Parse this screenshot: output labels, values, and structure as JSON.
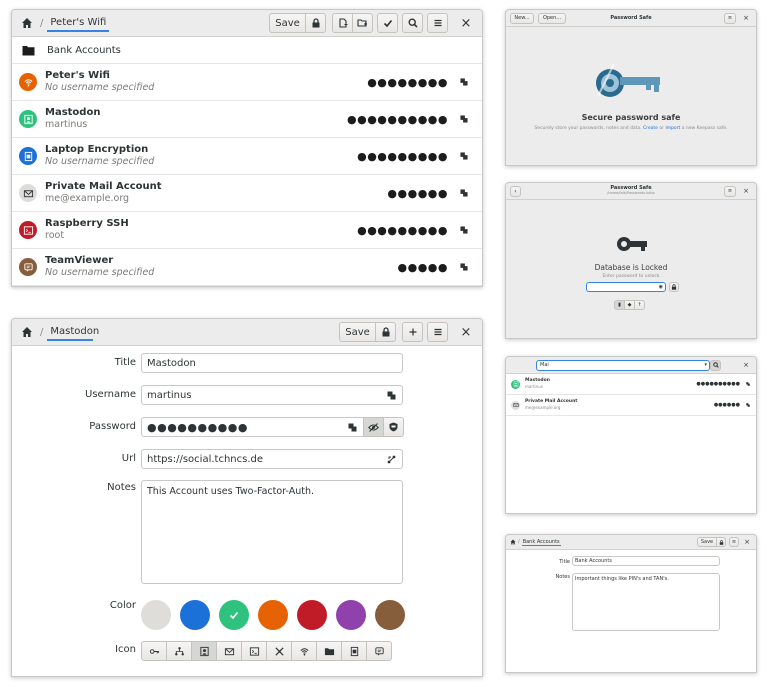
{
  "win1": {
    "breadcrumb": "Peter's Wifi",
    "save_label": "Save",
    "close": "×",
    "folder": "Bank Accounts",
    "entries": [
      {
        "title": "Peter's Wifi",
        "subtitle": "No username specified",
        "italic": true,
        "dots": "●●●●●●●●",
        "color": "#e66100",
        "icon": "wifi-icon"
      },
      {
        "title": "Mastodon",
        "subtitle": "martinus",
        "italic": false,
        "dots": "●●●●●●●●●●",
        "color": "#2ec27e",
        "icon": "contact-icon"
      },
      {
        "title": "Laptop Encryption",
        "subtitle": "No username specified",
        "italic": true,
        "dots": "●●●●●●●●●",
        "color": "#1c71d8",
        "icon": "lock-icon"
      },
      {
        "title": "Private Mail Account",
        "subtitle": "me@example.org",
        "italic": false,
        "dots": "●●●●●●",
        "color": "#deddda",
        "icon": "mail-icon"
      },
      {
        "title": "Raspberry SSH",
        "subtitle": "root",
        "italic": false,
        "dots": "●●●●●●●●●",
        "color": "#c01c28",
        "icon": "terminal-icon"
      },
      {
        "title": "TeamViewer",
        "subtitle": "No username specified",
        "italic": true,
        "dots": "●●●●●",
        "color": "#865e3c",
        "icon": "chat-icon"
      }
    ]
  },
  "win2": {
    "breadcrumb": "Mastodon",
    "save_label": "Save",
    "close": "×",
    "labels": {
      "title": "Title",
      "username": "Username",
      "password": "Password",
      "url": "Url",
      "notes": "Notes",
      "color": "Color",
      "icon": "Icon"
    },
    "values": {
      "title": "Mastodon",
      "username": "martinus",
      "password": "●●●●●●●●●●",
      "url": "https://social.tchncs.de",
      "notes": "This Account uses Two-Factor-Auth."
    },
    "colors": [
      "#deddda",
      "#1c71d8",
      "#2ec27e",
      "#e66100",
      "#c01c28",
      "#9141ac",
      "#865e3c"
    ],
    "selected_color": "#2ec27e",
    "icons": [
      "key-icon",
      "network-icon",
      "contact-icon",
      "mail-icon",
      "terminal-icon",
      "tools-icon",
      "wifi-icon",
      "folder-icon",
      "lock-icon",
      "chat-icon"
    ]
  },
  "win3": {
    "new_label": "New...",
    "open_label": "Open...",
    "title": "Password Safe",
    "heading": "Secure password safe",
    "desc_prefix": "Securely store your passwords, notes and data.",
    "desc_create": "Create",
    "desc_or": "or",
    "desc_import": "import",
    "desc_suffix": "a new Keepass safe."
  },
  "win4": {
    "title": "Password Safe",
    "path": "/home/falk/Passwords.kdbx",
    "heading": "Database is Locked",
    "desc": "Enter password to unlock"
  },
  "win5": {
    "search": "Mai",
    "entries": [
      {
        "title": "Mastodon",
        "subtitle": "martinus",
        "dots": "●●●●●●●●●●",
        "color": "#2ec27e"
      },
      {
        "title": "Private Mail Account",
        "subtitle": "me@example.org",
        "dots": "●●●●●●",
        "color": "#deddda"
      }
    ]
  },
  "win6": {
    "breadcrumb": "Bank Accounts",
    "save_label": "Save",
    "title_label": "Title",
    "title_value": "Bank Accounts",
    "notes_label": "Notes",
    "notes_value": "Important things like PIN's and TAN's."
  }
}
